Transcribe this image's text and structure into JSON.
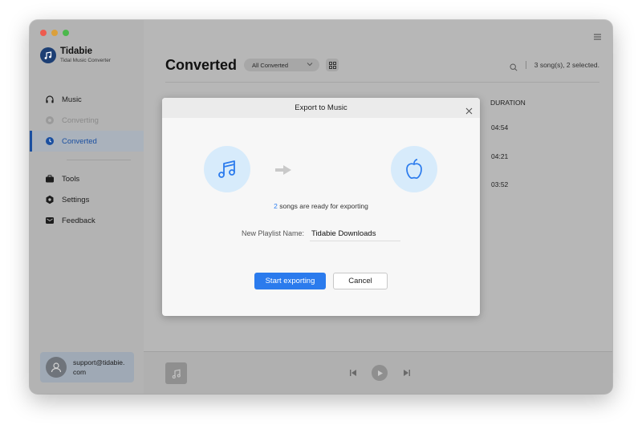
{
  "app": {
    "name": "Tidabie",
    "subtitle": "Tidal Music Converter"
  },
  "sidebar": {
    "items": [
      {
        "label": "Music",
        "icon": "headphones-icon"
      },
      {
        "label": "Converting",
        "icon": "converting-icon"
      },
      {
        "label": "Converted",
        "icon": "clock-icon"
      },
      {
        "label": "Tools",
        "icon": "toolbox-icon"
      },
      {
        "label": "Settings",
        "icon": "gear-icon"
      },
      {
        "label": "Feedback",
        "icon": "mail-icon"
      }
    ],
    "user_email": "support@tidabie.com"
  },
  "main": {
    "title": "Converted",
    "filter": "All Converted",
    "selection": "3 song(s), 2 selected.",
    "column_header": "DURATION",
    "durations": [
      "04:54",
      "04:21",
      "03:52"
    ]
  },
  "dialog": {
    "title": "Export to Music",
    "ready_count": "2",
    "ready_text": " songs are ready for exporting",
    "playlist_label": "New Playlist Name:",
    "playlist_value": "Tidabie Downloads",
    "start_label": "Start exporting",
    "cancel_label": "Cancel"
  },
  "colors": {
    "accent": "#2b7bed",
    "brand": "#1a4fa0",
    "icon_bg": "#d7ebfb"
  }
}
